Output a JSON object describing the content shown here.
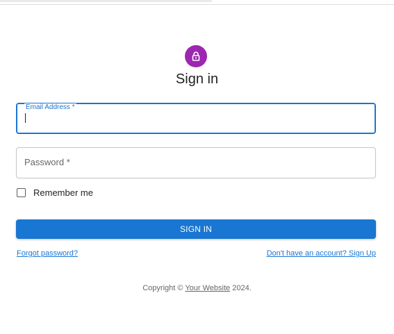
{
  "title": "Sign in",
  "avatar": {
    "icon": "lock-icon",
    "color": "#9c27b0"
  },
  "email": {
    "label": "Email Address *",
    "value": ""
  },
  "password": {
    "label": "Password *",
    "value": ""
  },
  "remember": {
    "label": "Remember me",
    "checked": false
  },
  "submit": {
    "label": "SIGN IN",
    "color": "#1976d2"
  },
  "links": {
    "forgot": "Forgot password?",
    "signup": "Don't have an account? Sign Up"
  },
  "footer": {
    "prefix": "Copyright © ",
    "link": "Your Website",
    "suffix": " 2024."
  }
}
